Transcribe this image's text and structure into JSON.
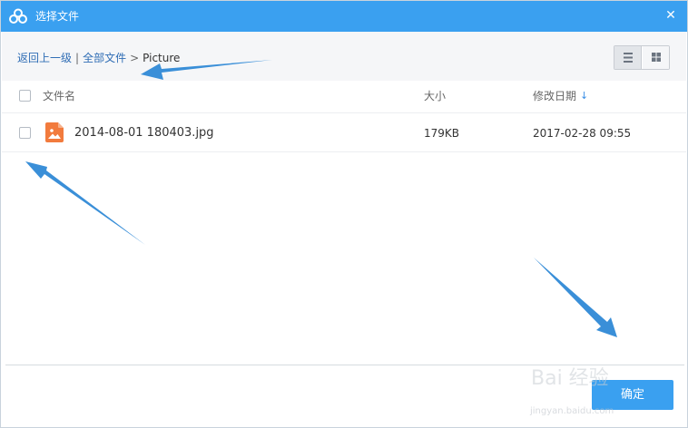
{
  "window": {
    "title": "选择文件",
    "close_symbol": "✕",
    "accent_color": "#3aa0f0"
  },
  "breadcrumb": {
    "back_label": "返回上一级",
    "divider": "|",
    "root_label": "全部文件",
    "arrow": ">",
    "current_label": "Picture"
  },
  "view_toggle": {
    "selected": "list",
    "options": [
      "list-icon",
      "grid-icon"
    ]
  },
  "table": {
    "columns": {
      "name": "文件名",
      "size": "大小",
      "date": "修改日期",
      "sort_indicator": "↓"
    },
    "rows": [
      {
        "icon": "image-file-icon",
        "name": "2014-08-01 180403.jpg",
        "size": "179KB",
        "date": "2017-02-28 09:55",
        "checked": false
      }
    ]
  },
  "footer": {
    "confirm_label": "确定"
  },
  "watermark": {
    "text": "Bai 经验",
    "sub": "jingyan.baidu.com"
  }
}
